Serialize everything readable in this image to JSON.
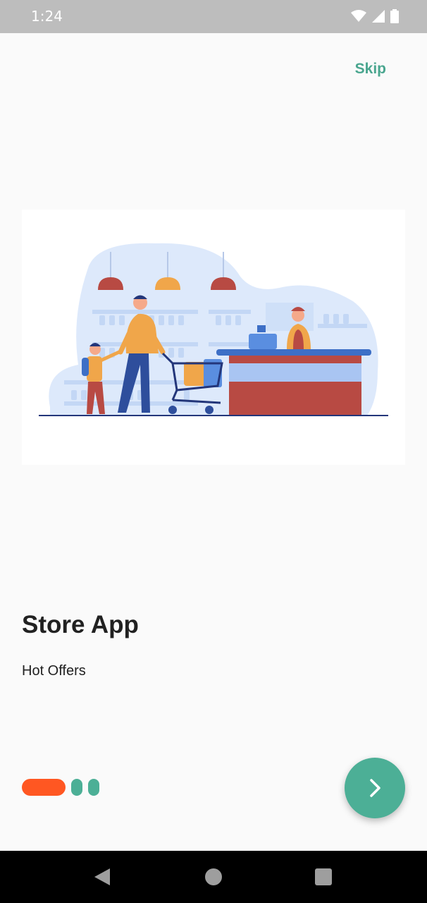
{
  "status_bar": {
    "time": "1:24"
  },
  "header": {
    "skip_label": "Skip"
  },
  "main": {
    "title": "Store App",
    "subtitle": "Hot Offers"
  },
  "pager": {
    "page_count": 3,
    "active_index": 0
  },
  "colors": {
    "accent": "#4caf96",
    "active_dot": "#ff5722",
    "title": "#212121"
  },
  "icons": {
    "next": "chevron-right-icon",
    "status": [
      "wifi-icon",
      "signal-icon",
      "battery-icon"
    ],
    "nav": [
      "back-icon",
      "home-icon",
      "recents-icon"
    ]
  }
}
